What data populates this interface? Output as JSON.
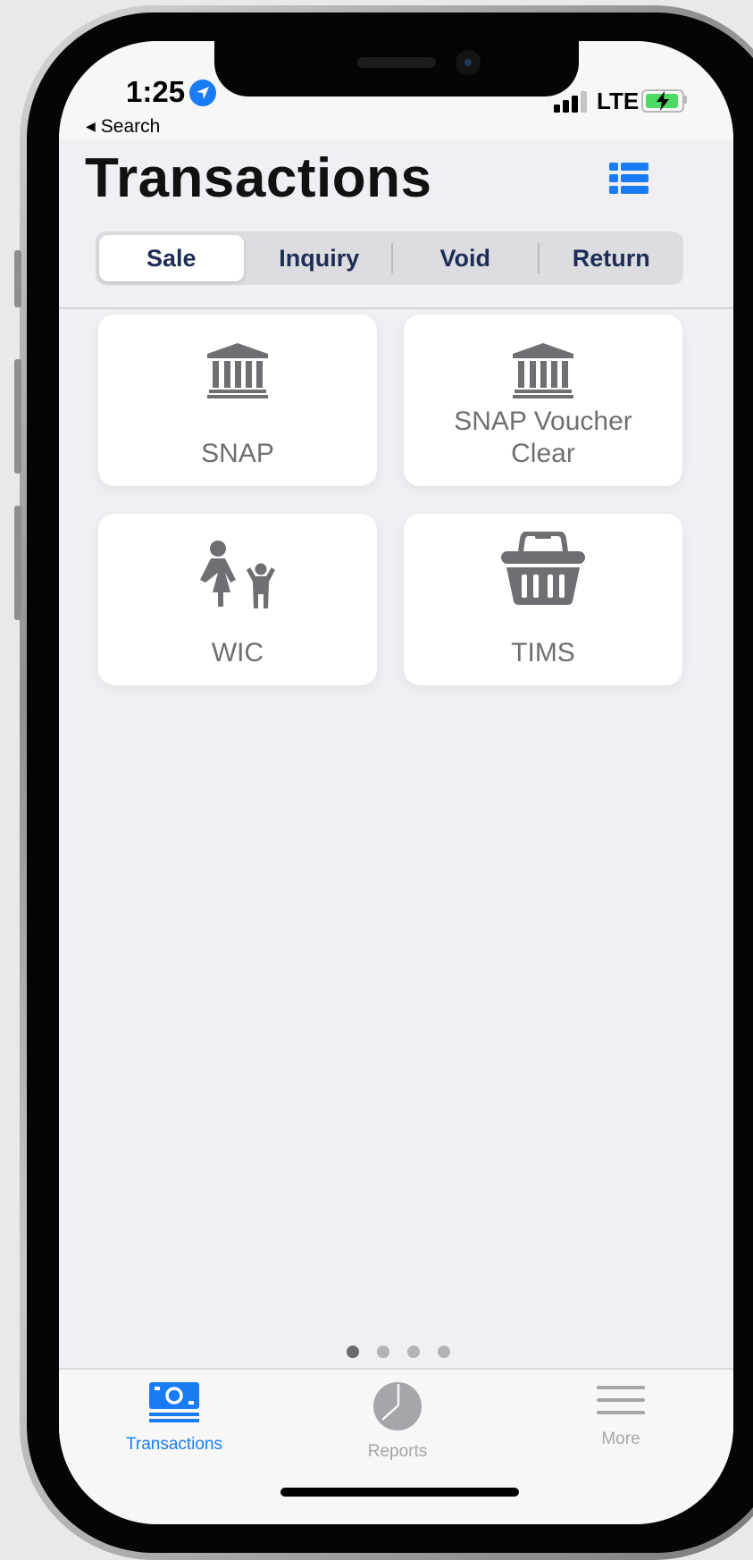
{
  "status_bar": {
    "time": "1:25",
    "back_label": "Search",
    "network": "LTE"
  },
  "header": {
    "title": "Transactions"
  },
  "segmented": {
    "items": [
      "Sale",
      "Inquiry",
      "Void",
      "Return"
    ],
    "selected": "Sale"
  },
  "tiles": [
    {
      "label": "SNAP",
      "icon": "bank-icon"
    },
    {
      "label": "SNAP Voucher Clear",
      "icon": "bank-icon"
    },
    {
      "label": "WIC",
      "icon": "mother-child-icon"
    },
    {
      "label": "TIMS",
      "icon": "basket-icon"
    }
  ],
  "pagination": {
    "pages": 4,
    "current": 1
  },
  "tabbar": {
    "items": [
      {
        "label": "Transactions",
        "icon": "cash-icon",
        "active": true
      },
      {
        "label": "Reports",
        "icon": "pie-chart-icon",
        "active": false
      },
      {
        "label": "More",
        "icon": "menu-icon",
        "active": false
      }
    ]
  },
  "colors": {
    "accent": "#1a7cf5",
    "segment_text": "#1d2d55",
    "tile_text": "#6f6f73",
    "inactive_tab": "#a6a6aa"
  }
}
